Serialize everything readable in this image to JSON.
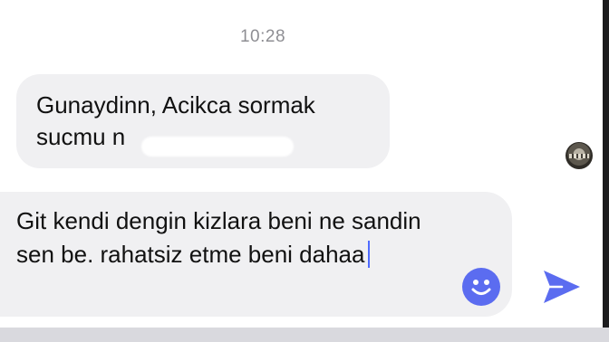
{
  "conversation": {
    "timestamp": "10:28",
    "incoming_message": {
      "text": "Gunaydinn, Acikca sormak sucmu n",
      "redacted": true
    },
    "contact_avatar": "contact-avatar-photo"
  },
  "composer": {
    "text": "Git kendi dengin kizlara beni ne sandin sen be. rahatsiz etme beni dahaa",
    "emoji_icon": "smiley-face-icon",
    "send_icon": "send-arrow-icon",
    "accent_color": "#5b6cf0"
  }
}
